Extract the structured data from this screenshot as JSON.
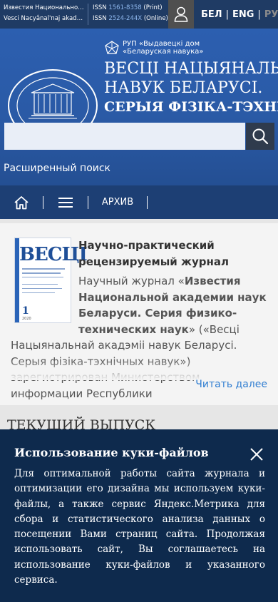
{
  "topbar": {
    "journal_name_1": "Известия Национальной академии наук Беларуси",
    "journal_name_2": "Vesci Nacyânal'naj akadèmii navuk Belarusì",
    "issn_label": "ISSN",
    "issn_print_num": "1561-8358",
    "issn_print_suffix": "(Print)",
    "issn_online_num": "2524-244X",
    "issn_online_suffix": "(Online)",
    "languages": [
      "БЕЛ",
      "ENG",
      "РУС"
    ],
    "separator": "|"
  },
  "banner": {
    "publisher_line1": "РУП «Выдавецкі дом",
    "publisher_line2": "«Беларуская навука»",
    "title_line1": "ВЕСЦІ НАЦЫЯНАЛЬНАЙ АКАДЭМІІ",
    "title_line2": "НАВУК БЕЛАРУСІ.",
    "series": "СЕРЫЯ ФІЗІКА-ТЭХНІЧНЫХ НАВУК"
  },
  "search": {
    "placeholder": "",
    "advanced_label": "Расширенный поиск"
  },
  "nav": {
    "archive_label": "АРХИВ"
  },
  "about": {
    "cover_title": "ВЕСЦІ",
    "cover_number": "1",
    "cover_year": "2020",
    "heading": "Научно-практический рецензируемый журнал",
    "text_start": "Научный журнал «",
    "text_bold": "Известия Национальной академии наук Беларуси. Серия физико-технических наук",
    "text_rest": "» («Весці Нацыянальнай акадэміі навук Беларусі. Серыя фізіка-тэхнічных навук») зарегистрирован Министерством информации Республики",
    "read_more": "Читать далее"
  },
  "current_issue": {
    "heading": "ТЕКУЩИЙ ВЫПУСК"
  },
  "cookie": {
    "title": "Использование куки-файлов",
    "text": "Для оптимальной работы сайта журнала и оптимизации его дизайна мы используем куки-файлы, а также сервис Яндекс.Метрика для сбора и статистического анализа данных о посещении Вами страниц сайта. Продолжая использовать сайт, Вы соглашаетесь на использование куки-файлов и указанного сервиса."
  },
  "colors": {
    "topbar": "#1f3b64",
    "banner": "#2a5aa6",
    "nav": "#1d3f74",
    "cookie": "#0e2a4d",
    "link": "#2f7dd1",
    "issn_number": "#8fb8ee"
  },
  "icons": {
    "user": "user-icon",
    "search": "search-icon",
    "home": "home-icon",
    "menu": "hamburger-menu-icon",
    "close": "close-icon",
    "publisher": "publisher-logo-icon",
    "emblem": "academy-emblem"
  }
}
